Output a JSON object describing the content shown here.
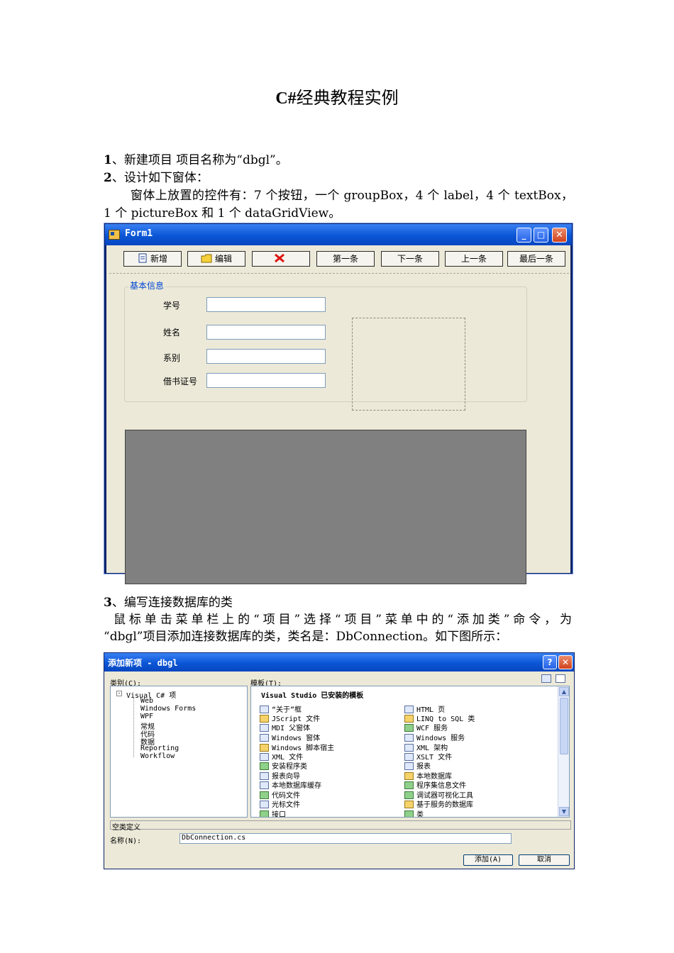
{
  "doc": {
    "title_bold": "C#",
    "title_rest": "经典教程实例",
    "step1_num": "1",
    "step1_text": "、新建项目 项目名称为“dbgl”。",
    "step2_num": "2",
    "step2_text": "、设计如下窗体：",
    "step2_desc1": "窗体上放置的控件有：7 个按钮，一个 groupBox，4 个 label，4 个 textBox，",
    "step2_desc2": "1 个 pictureBox 和 1 个 dataGridView。",
    "step3_num": "3",
    "step3_text": "、编写连接数据库的类",
    "step3_desc1": "鼠标单击菜单栏上的“项目”选择“项目”菜单中的“添加类”命令，为",
    "step3_desc2": "“dbgl”项目添加连接数据库的类，类名是：DbConnection。如下图所示："
  },
  "form1": {
    "title": "Form1",
    "minimize": "_",
    "maximize": "□",
    "close": "✕",
    "buttons": [
      {
        "label": "新增",
        "icon": "new-page-icon"
      },
      {
        "label": "编辑",
        "icon": "folder-icon"
      },
      {
        "label": "",
        "icon": "red-x-delete-icon"
      },
      {
        "label": "第一条",
        "icon": ""
      },
      {
        "label": "下一条",
        "icon": ""
      },
      {
        "label": "上一条",
        "icon": ""
      },
      {
        "label": "最后一条",
        "icon": ""
      }
    ],
    "groupbox_title": "基本信息",
    "labels": [
      "学号",
      "姓名",
      "系别",
      "借书证号"
    ]
  },
  "dialog": {
    "title": "添加新项 - dbgl",
    "help": "?",
    "close": "✕",
    "categories_label": "类别(C):",
    "templates_label": "模板(T):",
    "tree_root": "Visual C# 项",
    "tree_children": [
      "Web",
      "Windows Forms",
      "WPF",
      "常规",
      "代码",
      "数据",
      "Reporting",
      "Workflow"
    ],
    "templates_header": "Visual Studio 已安装的模板",
    "templates_left": [
      "“关于”框",
      "JScript 文件",
      "MDI 父窗体",
      "Windows 窗体",
      "Windows 脚本宿主",
      "XML 文件",
      "安装程序类",
      "报表向导",
      "本地数据库缓存",
      "代码文件",
      "光标文件",
      "接口"
    ],
    "templates_right": [
      "HTML 页",
      "LINQ to SQL 类",
      "WCF 服务",
      "Windows 服务",
      "XML 架构",
      "XSLT 文件",
      "报表",
      "本地数据库",
      "程序集信息文件",
      "调试器可视化工具",
      "基于服务的数据库",
      "类"
    ],
    "description": "空类定义",
    "name_label": "名称(N):",
    "name_value": "DbConnection.cs",
    "add_button": "添加(A)",
    "cancel_button": "取消"
  }
}
